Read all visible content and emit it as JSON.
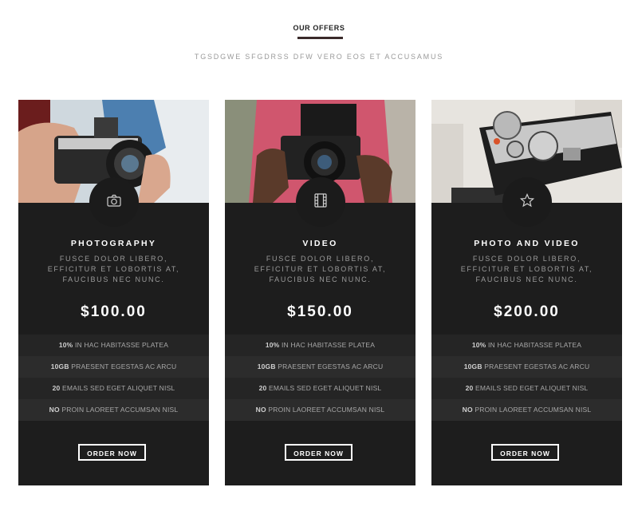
{
  "header": {
    "title": "OUR OFFERS",
    "subtitle": "TGSDGWE SFGDRSS DFW VERO EOS ET ACCUSAMUS"
  },
  "plans": [
    {
      "title": "PHOTOGRAPHY",
      "description": "FUSCE DOLOR LIBERO, EFFICITUR ET LOBORTIS AT, FAUCIBUS NEC NUNC.",
      "price": "$100.00",
      "icon": "camera-icon",
      "features": [
        {
          "strong": "10%",
          "text": " IN HAC HABITASSE PLATEA"
        },
        {
          "strong": "10GB",
          "text": " PRAESENT EGESTAS AC ARCU"
        },
        {
          "strong": "20",
          "text": " EMAILS SED EGET ALIQUET NISL"
        },
        {
          "strong": "NO",
          "text": " PROIN LAOREET ACCUMSAN NISL"
        }
      ],
      "button": "ORDER NOW"
    },
    {
      "title": "VIDEO",
      "description": "FUSCE DOLOR LIBERO, EFFICITUR ET LOBORTIS AT, FAUCIBUS NEC NUNC.",
      "price": "$150.00",
      "icon": "film-icon",
      "features": [
        {
          "strong": "10%",
          "text": " IN HAC HABITASSE PLATEA"
        },
        {
          "strong": "10GB",
          "text": " PRAESENT EGESTAS AC ARCU"
        },
        {
          "strong": "20",
          "text": " EMAILS SED EGET ALIQUET NISL"
        },
        {
          "strong": "NO",
          "text": " PROIN LAOREET ACCUMSAN NISL"
        }
      ],
      "button": "ORDER NOW"
    },
    {
      "title": "PHOTO AND VIDEO",
      "description": "FUSCE DOLOR LIBERO, EFFICITUR ET LOBORTIS AT, FAUCIBUS NEC NUNC.",
      "price": "$200.00",
      "icon": "star-icon",
      "features": [
        {
          "strong": "10%",
          "text": " IN HAC HABITASSE PLATEA"
        },
        {
          "strong": "10GB",
          "text": " PRAESENT EGESTAS AC ARCU"
        },
        {
          "strong": "20",
          "text": " EMAILS SED EGET ALIQUET NISL"
        },
        {
          "strong": "NO",
          "text": " PROIN LAOREET ACCUMSAN NISL"
        }
      ],
      "button": "ORDER NOW"
    }
  ],
  "colors": {
    "card_bg": "#1d1d1d",
    "accent_underline": "#3a2a2a",
    "text_white": "#ffffff",
    "text_muted": "#9a9a9a"
  }
}
